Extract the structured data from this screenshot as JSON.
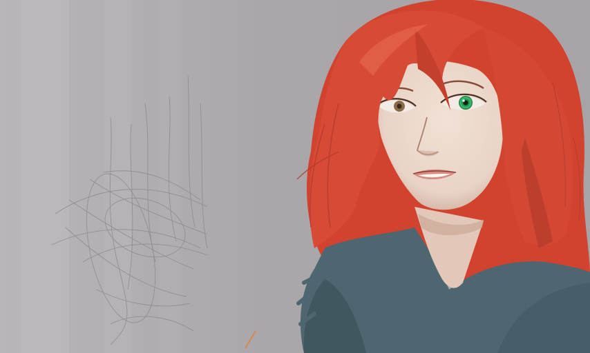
{
  "scene": {
    "subject": "portrait",
    "palette": {
      "background": "#a8a4a8",
      "background_light": "#c4c0c3",
      "hair": "#d64a36",
      "hair_shadow": "#b23a2b",
      "hair_highlight": "#e86a4e",
      "skin": "#ecd8cc",
      "skin_shadow": "#c9a796",
      "eye_iris": "#2fb063",
      "lips": "#d88a80",
      "sweater": "#4e6670",
      "sweater_shadow": "#3f545d",
      "sketch_lines": "#8a878c",
      "orange_stroke": "#e0823a"
    }
  }
}
